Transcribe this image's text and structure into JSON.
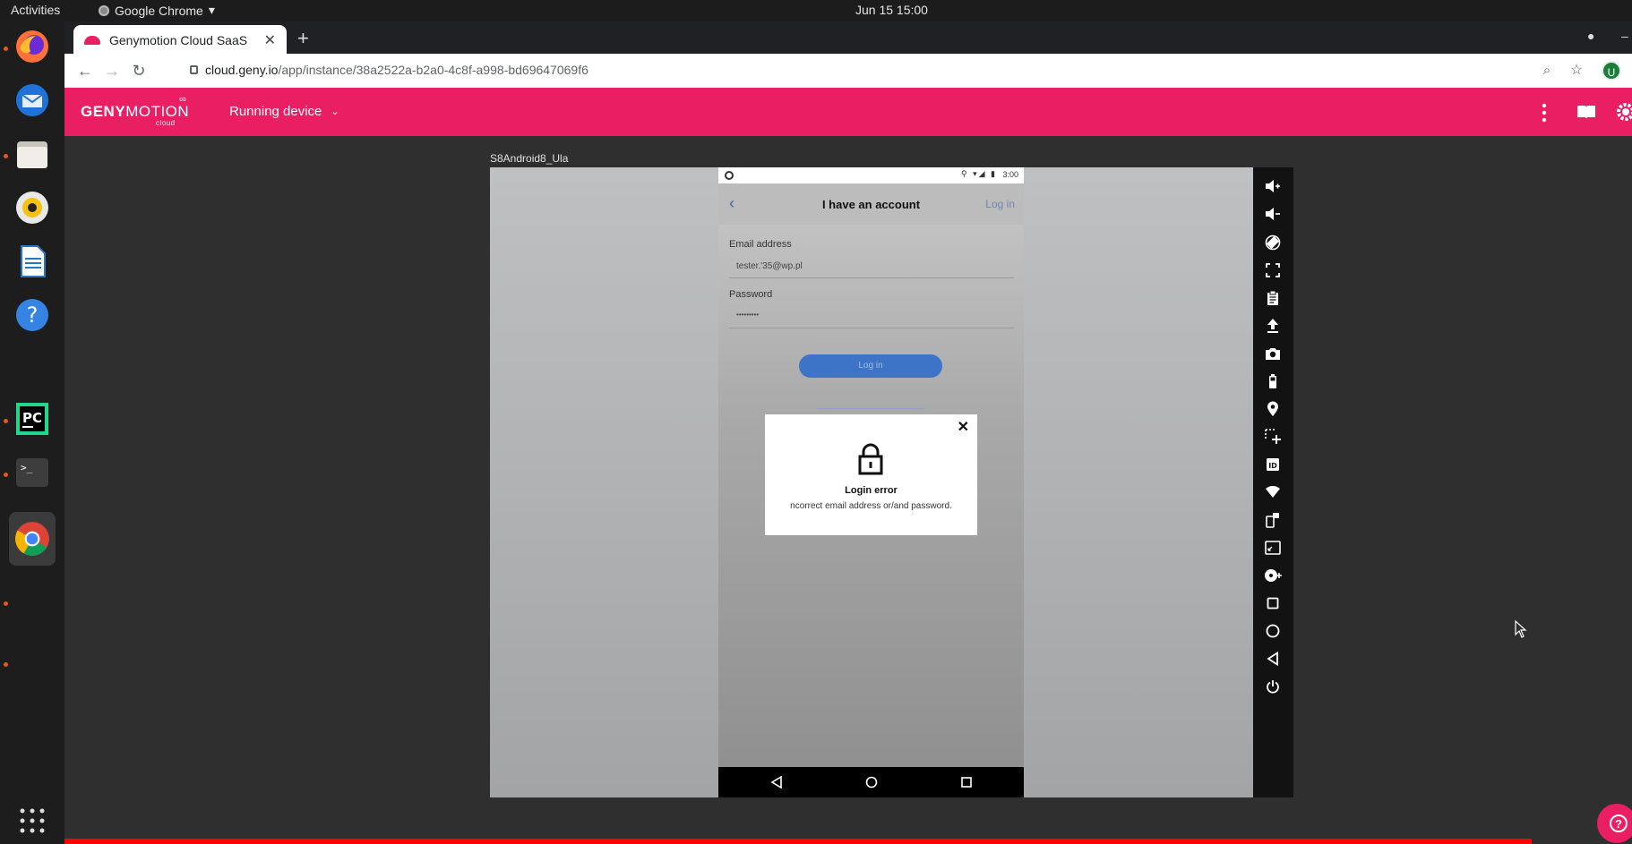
{
  "system": {
    "activities": "Activities",
    "app_name": "Google Chrome",
    "clock": "Jun 15  15:00"
  },
  "browser": {
    "tab_title": "Genymotion Cloud SaaS",
    "url_host": "cloud.geny.io",
    "url_path": "/app/instance/38a2522a-b2a0-4c8f-a998-bd69647069f6",
    "avatar_letter": "U"
  },
  "genymotion": {
    "logo_main": "GENY",
    "logo_thin": "MOTION",
    "logo_sub": "cloud",
    "device_menu": "Running device",
    "device_name": "S8Android8_Ula"
  },
  "phone": {
    "status_time": "3:00",
    "screen_title": "I have an account",
    "login_link": "Log in",
    "email_label": "Email address",
    "email_value": "tester.'35@wp.pl",
    "password_label": "Password",
    "password_value": "•••••••••",
    "login_button": "Log in",
    "dialog": {
      "title": "Login error",
      "message": "ncorrect email address or/and password."
    }
  },
  "toolbar_icons": [
    "volume-up-icon",
    "volume-down-icon",
    "rotate-icon",
    "fullscreen-icon",
    "clipboard-icon",
    "upload-icon",
    "camera-icon",
    "battery-icon",
    "gps-icon",
    "capture-icon",
    "device-id-icon",
    "wifi-icon",
    "phone-sms-icon",
    "screen-size-icon",
    "disk-icon",
    "recent-apps-icon",
    "home-icon",
    "back-icon",
    "power-icon"
  ],
  "colors": {
    "brand": "#e91e63",
    "toolbar": "#121212",
    "accent_blue": "#3e74c7"
  }
}
